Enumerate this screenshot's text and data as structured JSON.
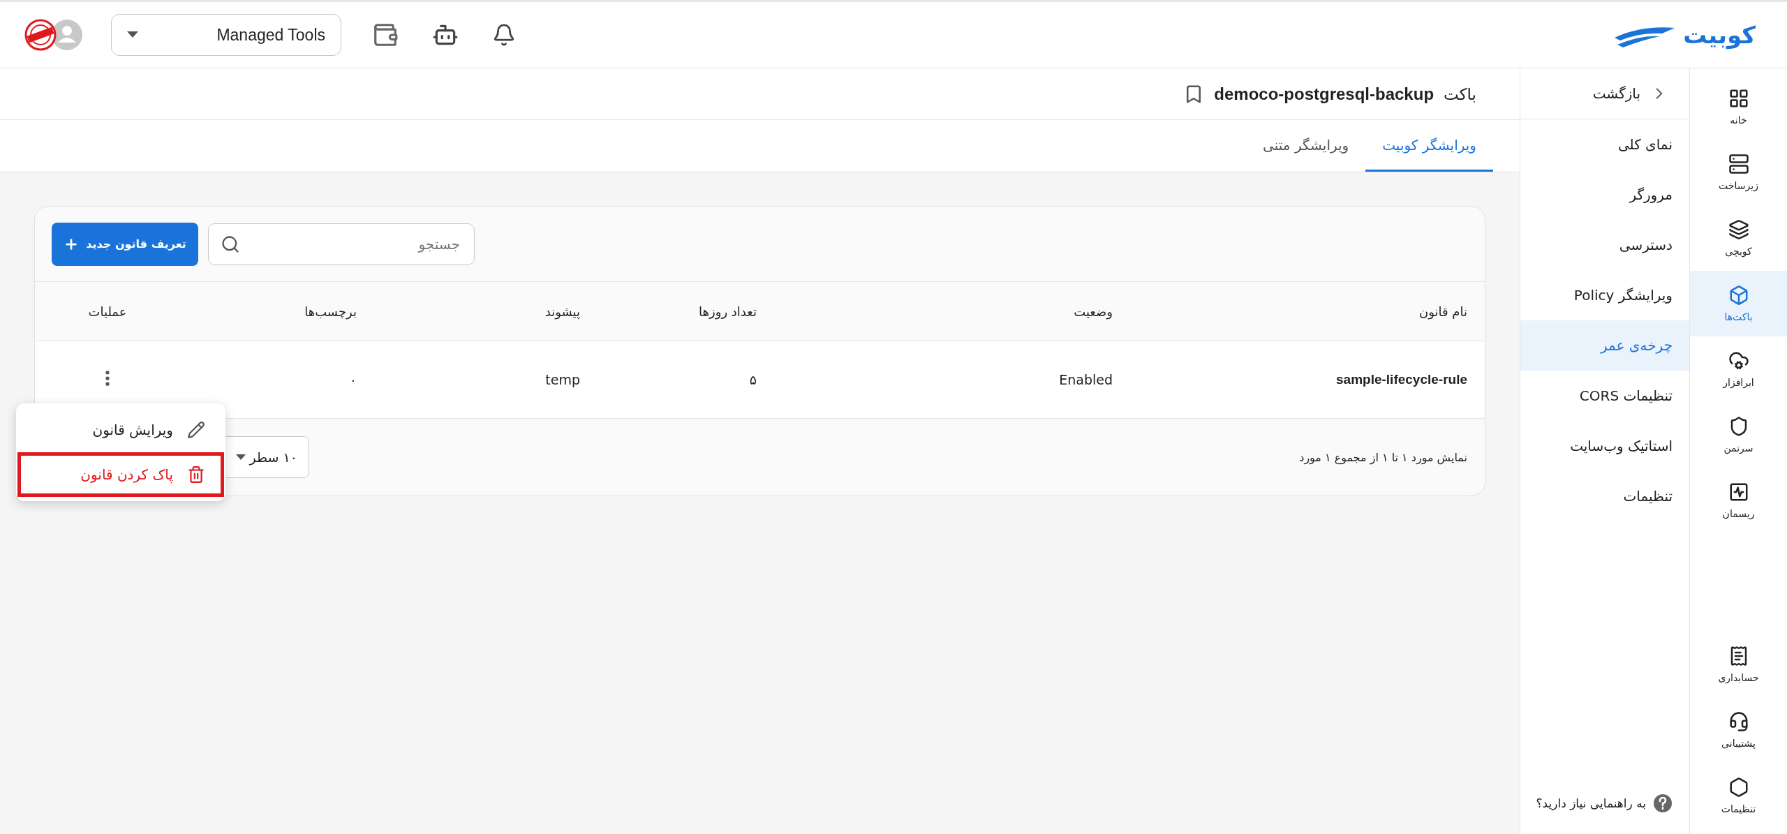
{
  "topbar": {
    "logo": "کوبیت",
    "project": "Managed Tools"
  },
  "rail": {
    "items": [
      {
        "label": "خانه",
        "selected": false
      },
      {
        "label": "زیرساخت",
        "selected": false
      },
      {
        "label": "کوبچی",
        "selected": false
      },
      {
        "label": "باکت‌ها",
        "selected": true
      },
      {
        "label": "ابرافزار",
        "selected": false
      },
      {
        "label": "سرتمن",
        "selected": false
      },
      {
        "label": "ریسمان",
        "selected": false
      }
    ],
    "bottom_items": [
      {
        "label": "حسابداری",
        "selected": false
      },
      {
        "label": "پشتیبانی",
        "selected": false
      },
      {
        "label": "تنظیمات",
        "selected": false
      }
    ]
  },
  "side_menu": {
    "back": "بازگشت",
    "items": [
      {
        "label": "نمای کلی",
        "selected": false
      },
      {
        "label": "مرورگر",
        "selected": false
      },
      {
        "label": "دسترسی",
        "selected": false
      },
      {
        "label": "ویرایشگر Policy",
        "selected": false
      },
      {
        "label": "چرخه‌ی عمر",
        "selected": true
      },
      {
        "label": "تنظیمات CORS",
        "selected": false
      },
      {
        "label": "استاتیک وب‌سایت",
        "selected": false
      },
      {
        "label": "تنظیمات",
        "selected": false
      }
    ],
    "help": "به راهنمایی نیاز دارید؟"
  },
  "bucket": {
    "prefix": "باکت",
    "name": "democo-postgresql-backup"
  },
  "tabs": [
    {
      "label": "ویرایشگر کوبیت",
      "selected": true
    },
    {
      "label": "ویرایشگر متنی",
      "selected": false
    }
  ],
  "toolbar": {
    "search_placeholder": "جستجو",
    "new_button": "تعریف قانون جدید"
  },
  "table": {
    "columns": [
      "نام قانون",
      "وضعیت",
      "تعداد روزها",
      "پیشوند",
      "برچسب‌ها",
      "عملیات"
    ],
    "rows": [
      {
        "cells": [
          "sample-lifecycle-rule",
          "Enabled",
          "۵",
          "temp",
          "۰"
        ]
      }
    ]
  },
  "footer": {
    "summary": "نمایش مورد ۱ تا ۱ از مجموع ۱ مورد",
    "page_size": "۱۰ سطر"
  },
  "row_menu": {
    "items": [
      {
        "label": "ویرایش قانون",
        "kind": "edit",
        "highlighted": false
      },
      {
        "label": "پاک کردن قانون",
        "kind": "delete",
        "highlighted": true
      }
    ]
  }
}
